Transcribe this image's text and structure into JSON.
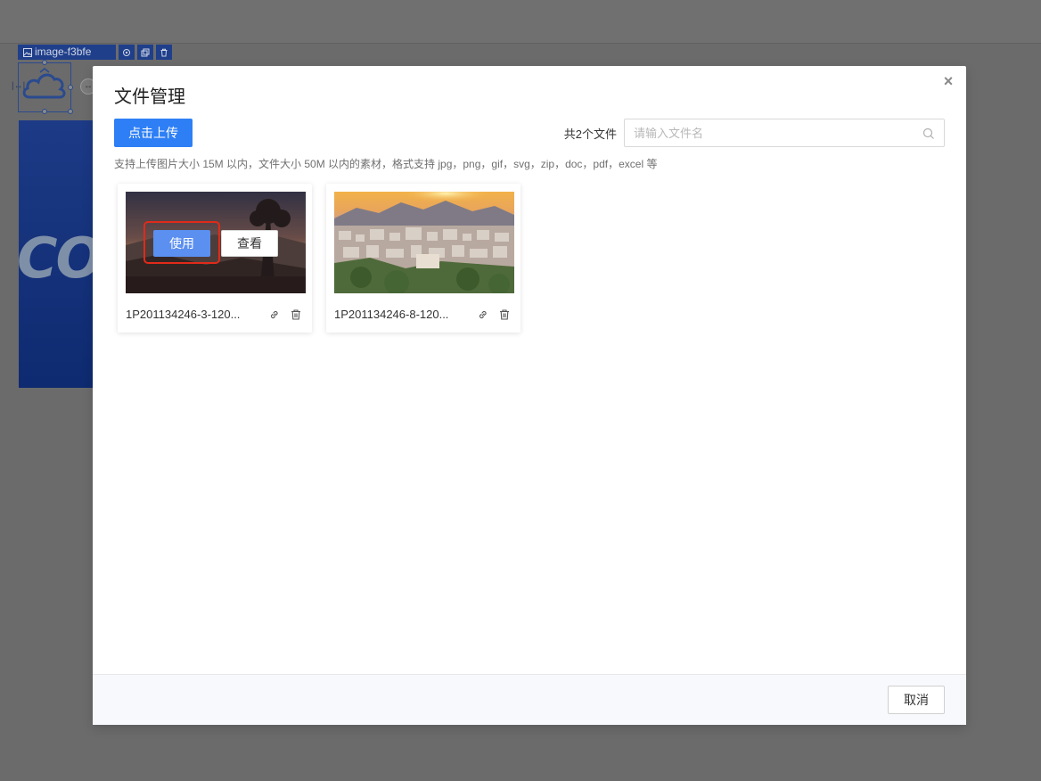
{
  "editor": {
    "element_name": "image-f3bfe",
    "toolbar_icons": [
      "settings-icon",
      "copy-icon",
      "delete-icon"
    ]
  },
  "modal": {
    "title": "文件管理",
    "upload_label": "点击上传",
    "file_count": "共2个文件",
    "search_placeholder": "请输入文件名",
    "hint": "支持上传图片大小 15M 以内，文件大小 50M 以内的素材，格式支持 jpg，png，gif，svg，zip，doc，pdf，excel 等",
    "files": [
      {
        "name": "1P201134246-3-120...",
        "hover_use": "使用",
        "hover_view": "查看"
      },
      {
        "name": "1P201134246-8-120..."
      }
    ],
    "cancel_label": "取消"
  },
  "colors": {
    "primary": "#2e7ff6",
    "highlight": "#e02a1a",
    "overlay": "#6b6b6b"
  }
}
